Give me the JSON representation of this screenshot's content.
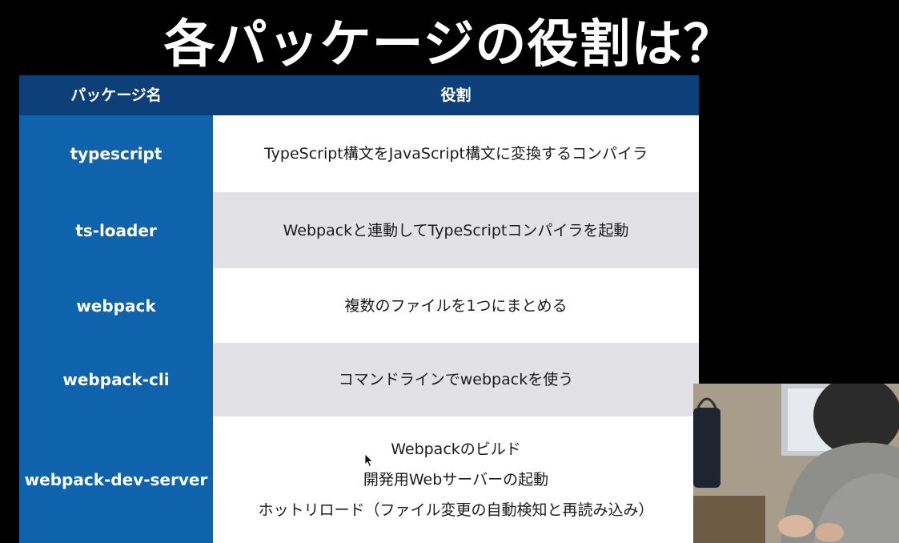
{
  "slide": {
    "title": "各パッケージの役割は？"
  },
  "table": {
    "headers": [
      "パッケージ名",
      "役割"
    ],
    "rows": [
      {
        "package": "typescript",
        "role": [
          "TypeScript構文をJavaScript構文に変換するコンパイラ"
        ]
      },
      {
        "package": "ts-loader",
        "role": [
          "Webpackと連動してTypeScriptコンパイラを起動"
        ]
      },
      {
        "package": "webpack",
        "role": [
          "複数のファイルを1つにまとめる"
        ]
      },
      {
        "package": "webpack-cli",
        "role": [
          "コマンドラインでwebpackを使う"
        ]
      },
      {
        "package": "webpack-dev-server",
        "role": [
          "Webpackのビルド",
          "開発用Webサーバーの起動",
          "ホットリロード（ファイル変更の自動検知と再読み込み）"
        ]
      }
    ]
  },
  "colors": {
    "header_bg": "#0d3f78",
    "package_col_bg": "#0f63ad",
    "row_white": "#ffffff",
    "row_grey": "#e1e1e6",
    "page_bg": "#000000"
  },
  "icons": [
    "mouse-pointer-icon"
  ]
}
